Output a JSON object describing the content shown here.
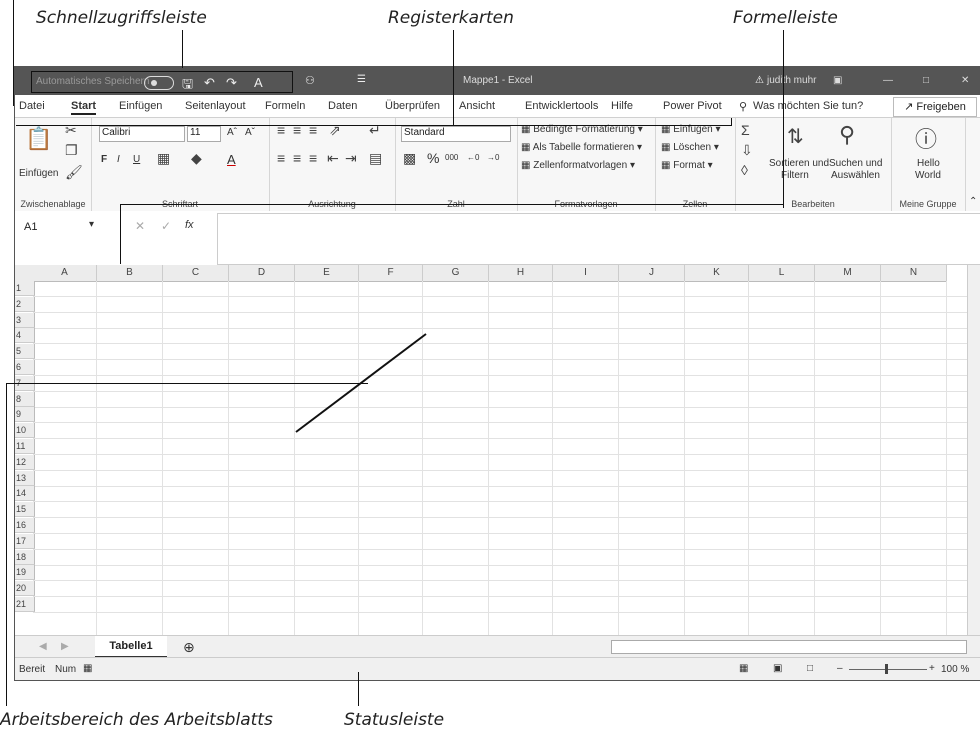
{
  "callouts": {
    "qat": "Schnellzugriffsleiste",
    "tabs": "Registerkarten",
    "formula": "Formelleiste",
    "worksheet": "Arbeitsbereich des Arbeitsblatts",
    "status": "Statusleiste"
  },
  "titlebar": {
    "autosave": "Automatisches Speichern",
    "title": "Mappe1  -  Excel",
    "user": "judith muhr"
  },
  "tabs": [
    "Datei",
    "Start",
    "Einfügen",
    "Seitenlayout",
    "Formeln",
    "Daten",
    "Überprüfen",
    "Ansicht",
    "Entwicklertools",
    "Hilfe",
    "Power Pivot"
  ],
  "tell_me": "Was möchten Sie tun?",
  "share": "Freigeben",
  "ribbon": {
    "clipboard": {
      "paste": "Einfügen",
      "label": "Zwischenablage"
    },
    "font": {
      "name": "Calibri",
      "size": "11",
      "bold": "F",
      "italic": "I",
      "underline": "U",
      "label": "Schriftart"
    },
    "alignment": {
      "label": "Ausrichtung"
    },
    "number": {
      "format": "Standard",
      "label": "Zahl"
    },
    "styles": {
      "cond": "Bedingte Formatierung",
      "table": "Als Tabelle formatieren",
      "cell": "Zellenformatvorlagen",
      "label": "Formatvorlagen"
    },
    "cells": {
      "insert": "Einfügen",
      "delete": "Löschen",
      "format": "Format",
      "label": "Zellen"
    },
    "editing": {
      "sort1": "Sortieren und",
      "sort2": "Filtern",
      "find1": "Suchen und",
      "find2": "Auswählen",
      "label": "Bearbeiten"
    },
    "custom": {
      "hello1": "Hello",
      "hello2": "World",
      "label": "Meine Gruppe"
    }
  },
  "namebox": "A1",
  "columns": [
    "A",
    "B",
    "C",
    "D",
    "E",
    "F",
    "G",
    "H",
    "I",
    "J",
    "K",
    "L",
    "M",
    "N"
  ],
  "rows": [
    "1",
    "2",
    "3",
    "4",
    "5",
    "6",
    "7",
    "8",
    "9",
    "10",
    "11",
    "12",
    "13",
    "14",
    "15",
    "16",
    "17",
    "18",
    "19",
    "20",
    "21"
  ],
  "sheet": {
    "tab": "Tabelle1"
  },
  "status": {
    "ready": "Bereit",
    "num": "Num",
    "zoom": "100 %"
  }
}
